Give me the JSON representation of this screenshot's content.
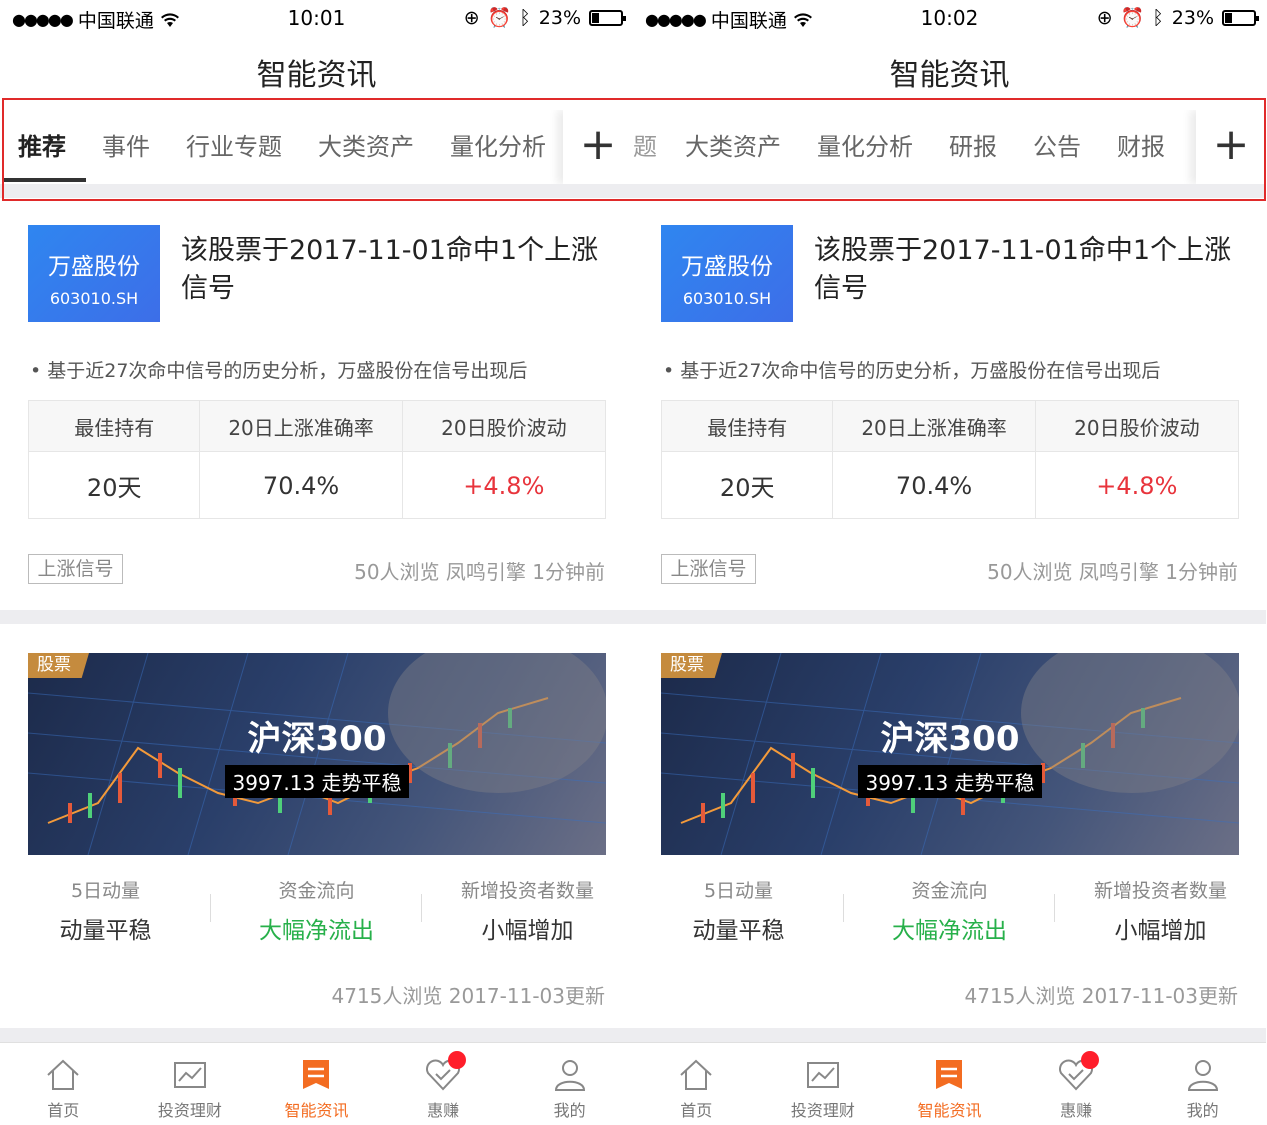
{
  "status": {
    "carrier": "中国联通",
    "battery": "23%",
    "time_left": "10:01",
    "time_right": "10:02"
  },
  "nav_title": "智能资讯",
  "tabs": [
    "推荐",
    "事件",
    "行业专题",
    "大类资产",
    "量化分析",
    "研报",
    "公告",
    "财报"
  ],
  "tab_partial_right": "题",
  "tab_plus": "+",
  "card1": {
    "stock_name": "万盛股份",
    "stock_code": "603010.SH",
    "headline": "该股票于2017-11-01命中1个上涨信号",
    "description": "• 基于近27次命中信号的历史分析，万盛股份在信号出现后",
    "headers": [
      "最佳持有",
      "20日上涨准确率",
      "20日股价波动"
    ],
    "values": [
      "20天",
      "70.4%",
      "+4.8%"
    ],
    "tag": "上涨信号",
    "meta": "50人浏览  凤鸣引擎  1分钟前"
  },
  "card2": {
    "tag": "股票",
    "title": "沪深300",
    "subtitle": "3997.13  走势平稳",
    "metrics": [
      {
        "label": "5日动量",
        "value": "动量平稳"
      },
      {
        "label": "资金流向",
        "value": "大幅净流出"
      },
      {
        "label": "新增投资者数量",
        "value": "小幅增加"
      }
    ],
    "meta": "4715人浏览  2017-11-03更新"
  },
  "bottom_nav": [
    "首页",
    "投资理财",
    "智能资讯",
    "惠赚",
    "我的"
  ],
  "colors": {
    "accent": "#f36c21",
    "up_red": "#e8343c",
    "flow_green": "#27b04a",
    "badge_blue": "#2f86f0",
    "highlight": "#e02a2a"
  }
}
